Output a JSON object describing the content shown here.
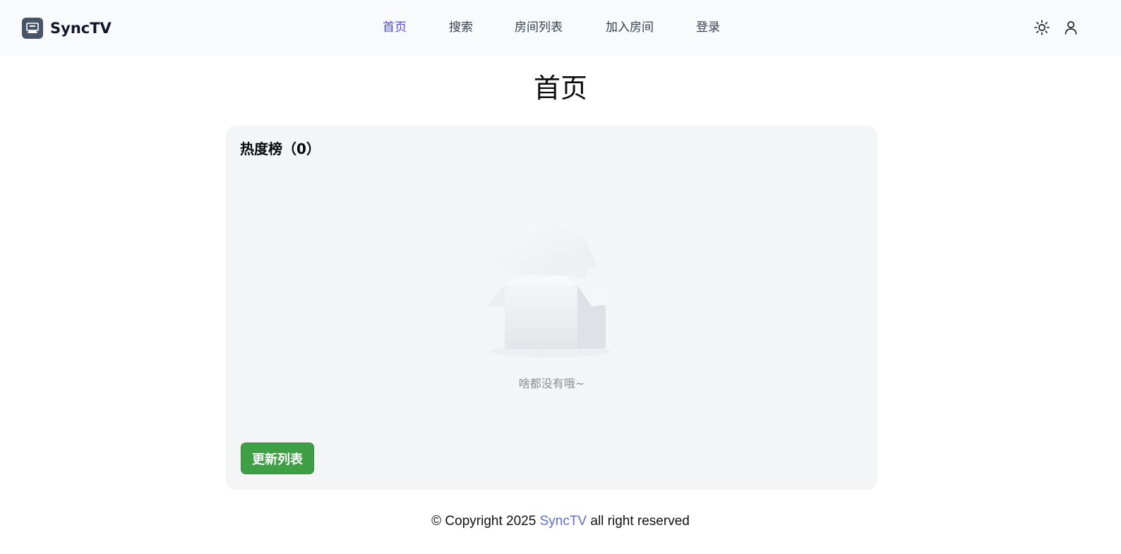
{
  "header": {
    "app_name": "SyncTV",
    "logo_icon": "tv-logo-icon",
    "nav": [
      {
        "label": "首页",
        "active": true
      },
      {
        "label": "搜索",
        "active": false
      },
      {
        "label": "房间列表",
        "active": false
      },
      {
        "label": "加入房间",
        "active": false
      },
      {
        "label": "登录",
        "active": false
      }
    ],
    "theme_icon": "sun-icon",
    "user_icon": "user-icon",
    "accent_color": "#4f46e5"
  },
  "main": {
    "title": "首页",
    "hot_list": {
      "title": "热度榜（0）",
      "empty_text": "啥都没有哦~",
      "refresh_label": "更新列表",
      "refresh_color": "#3f9f44"
    }
  },
  "footer": {
    "prefix": "© Copyright 2025 ",
    "brand": "SyncTV",
    "suffix": " all right reserved"
  }
}
